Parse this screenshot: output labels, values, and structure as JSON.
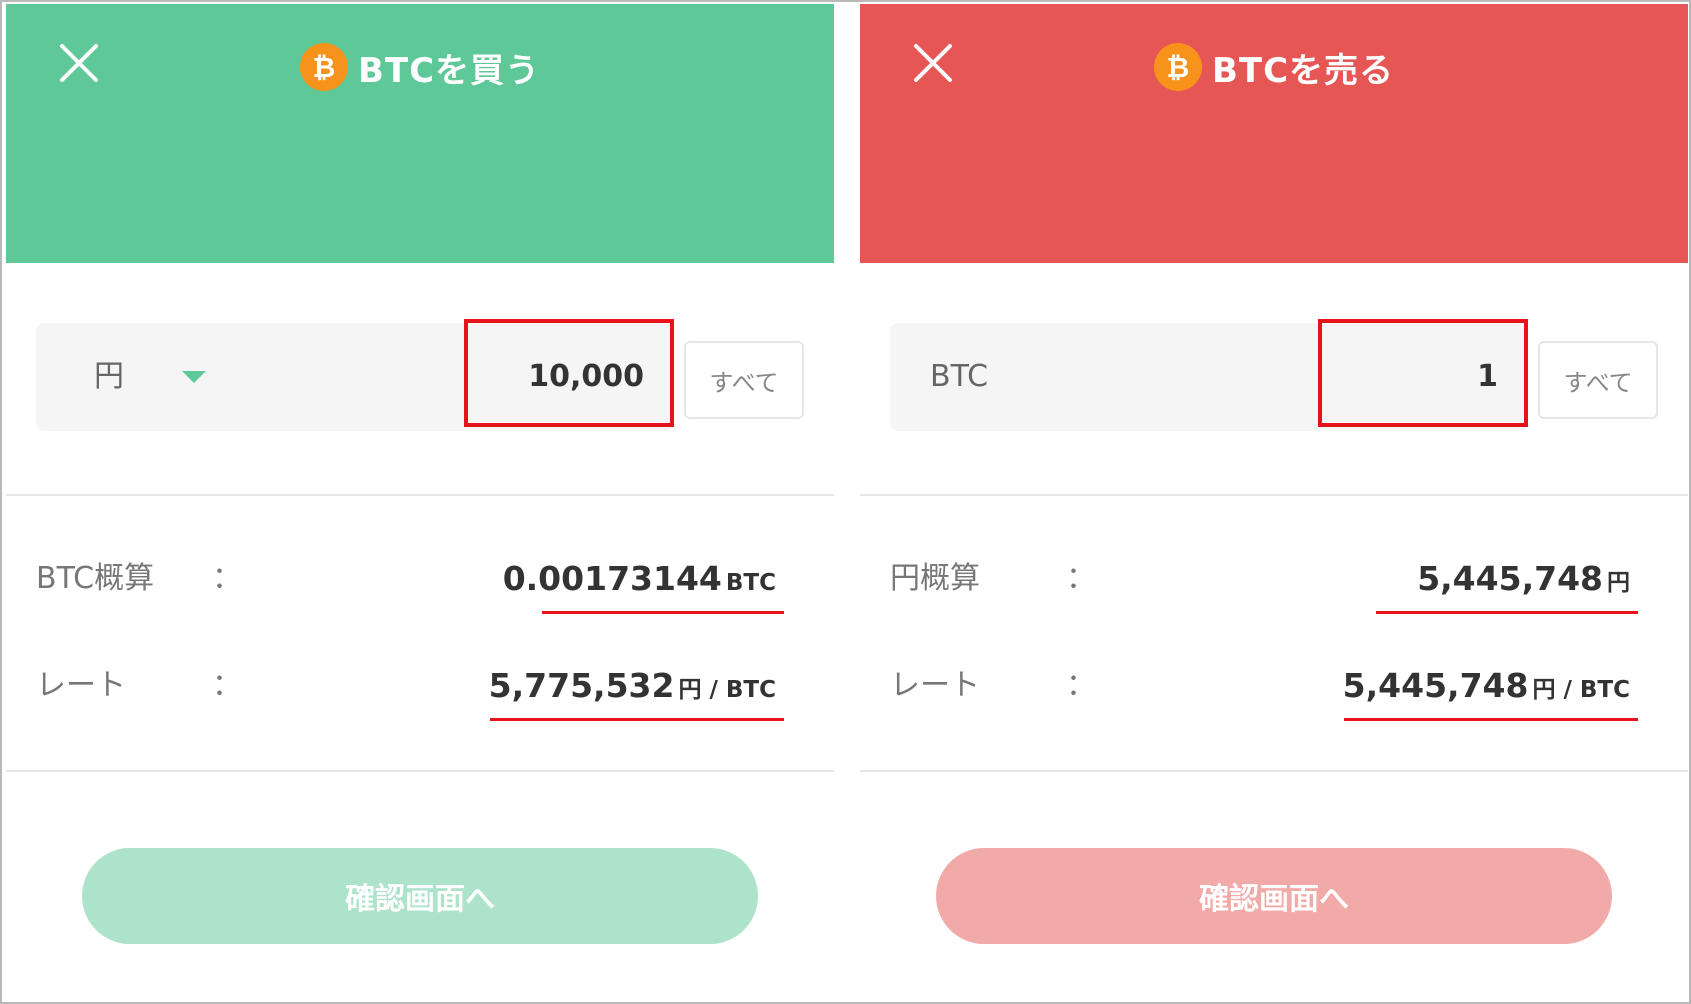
{
  "colors": {
    "buy_accent": "#5ec898",
    "sell_accent": "#e65655",
    "highlight": "#e8121d",
    "btc_orange": "#f7931a"
  },
  "buy": {
    "title": "BTCを買う",
    "coin_icon": "bitcoin-icon",
    "coin_symbol": "₿",
    "unit_label": "円",
    "amount": "10,000",
    "all_button": "すべて",
    "estimate_label": "BTC概算",
    "colon": "：",
    "estimate_value": "0.00173144",
    "estimate_unit": "BTC",
    "rate_label": "レート",
    "rate_value": "5,775,532",
    "rate_unit": "円 / BTC",
    "confirm_label": "確認画面へ"
  },
  "sell": {
    "title": "BTCを売る",
    "coin_icon": "bitcoin-icon",
    "coin_symbol": "₿",
    "unit_label": "BTC",
    "amount": "1",
    "all_button": "すべて",
    "estimate_label": "円概算",
    "colon": "：",
    "estimate_value": "5,445,748",
    "estimate_unit": "円",
    "rate_label": "レート",
    "rate_value": "5,445,748",
    "rate_unit": "円 / BTC",
    "confirm_label": "確認画面へ"
  }
}
